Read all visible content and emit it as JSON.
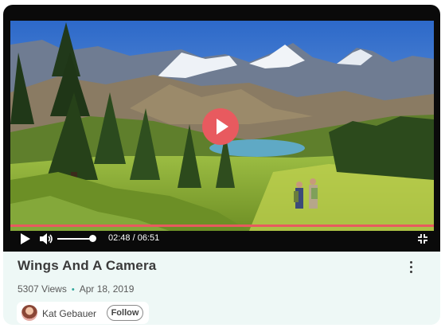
{
  "video": {
    "title": "Wings And A Camera",
    "current_time": "02:48",
    "duration": "06:51",
    "time_display": "02:48 / 06:51",
    "progress_percent": 100,
    "volume_percent": 80,
    "colors": {
      "accent": "#e85a5f",
      "player_bg": "#0a0a0a",
      "card_bg": "#eef8f6"
    }
  },
  "meta": {
    "views": "5307 Views",
    "separator": "•",
    "date": "Apr 18, 2019"
  },
  "author": {
    "name": "Kat Gebauer",
    "follow_label": "Follow"
  },
  "icons": {
    "play": "play-icon",
    "volume": "volume-icon",
    "fullscreen_exit": "fullscreen-exit-icon",
    "more": "more-vertical-icon"
  }
}
